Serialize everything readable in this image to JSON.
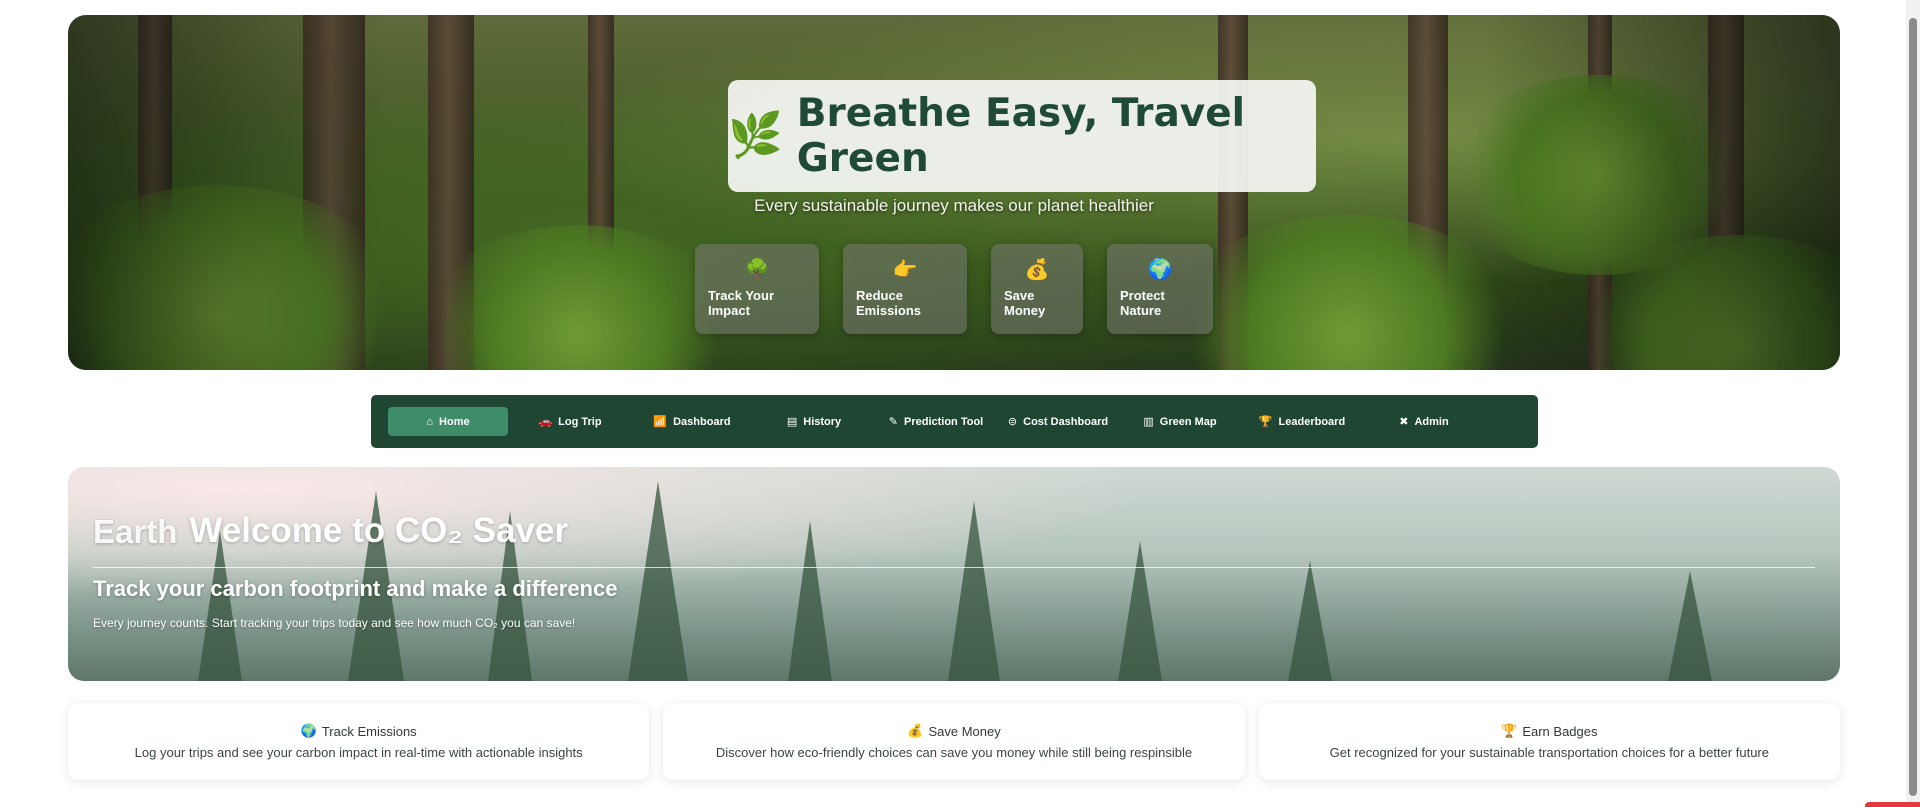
{
  "hero": {
    "title_icon": "🌿",
    "title": "Breathe Easy, Travel Green",
    "subtitle": "Every sustainable journey makes our planet healthier",
    "features": [
      {
        "icon": "🌳",
        "icon_name": "tree-icon",
        "label": "Track Your Impact"
      },
      {
        "icon": "👉",
        "icon_name": "pointing-hand-icon",
        "label": "Reduce Emissions"
      },
      {
        "icon": "💰",
        "icon_name": "money-bag-icon",
        "label": "Save Money"
      },
      {
        "icon": "🌍",
        "icon_name": "globe-icon",
        "label": "Protect Nature"
      }
    ]
  },
  "nav": {
    "items": [
      {
        "icon": "⌂",
        "label": "Home",
        "active": true
      },
      {
        "icon": "🚗",
        "label": "Log Trip"
      },
      {
        "icon": "📶",
        "label": "Dashboard"
      },
      {
        "icon": "▤",
        "label": "History"
      },
      {
        "icon": "✎",
        "label": "Prediction Tool"
      },
      {
        "icon": "⊜",
        "label": "Cost Dashboard"
      },
      {
        "icon": "▥",
        "label": "Green Map"
      },
      {
        "icon": "🏆",
        "label": "Leaderboard"
      },
      {
        "icon": "✖",
        "label": "Admin"
      }
    ]
  },
  "welcome": {
    "image_alt": "Earth",
    "title": "Welcome to CO₂ Saver",
    "subtitle": "Track your carbon footprint and make a difference",
    "description": "Every journey counts. Start tracking your trips today and see how much CO₂ you can save!"
  },
  "info_cards": [
    {
      "icon": "🌍",
      "title": "Track Emissions",
      "description": "Log your trips and see your carbon impact in real-time with actionable insights"
    },
    {
      "icon": "💰",
      "title": "Save Money",
      "description": "Discover how eco-friendly choices can save you money while still being respinsible"
    },
    {
      "icon": "🏆",
      "title": "Earn Badges",
      "description": "Get recognized for your sustainable transportation choices for a better future"
    }
  ],
  "colors": {
    "primary_dark": "#1e4632",
    "nav_active": "#3e8c68",
    "title_text": "#1f4a36"
  }
}
